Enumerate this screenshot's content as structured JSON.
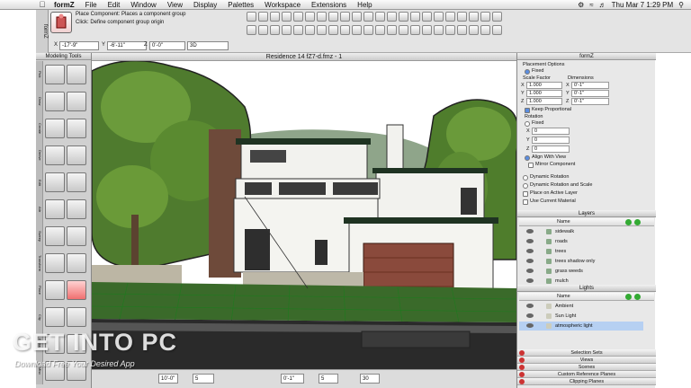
{
  "menubar": {
    "app": "formZ",
    "items": [
      "File",
      "Edit",
      "Window",
      "View",
      "Display",
      "Palettes",
      "Workspace",
      "Extensions",
      "Help"
    ],
    "clock": "Thu Mar 7  1:29 PM"
  },
  "toolbar": {
    "side_label": "formZ",
    "place_title": "Place Component:",
    "place_desc": "Places a component group",
    "place_hint": "Click: Define component group origin",
    "coords": {
      "x_label": "X",
      "x": "-17'-9\"",
      "y_label": "Y",
      "y": "-6'-11\"",
      "z_label": "Z",
      "z": "0'-0\"",
      "mode": "3D"
    }
  },
  "tools": {
    "title": "Modeling Tools",
    "groups": [
      "Pick",
      "Draw",
      "Create",
      "Derive",
      "Edit",
      "Attr",
      "Sweep",
      "Transform",
      "Place",
      "Clip",
      "Extras",
      "Misc"
    ]
  },
  "viewport": {
    "title": "Residence 14 fZ7-d.fmz - 1"
  },
  "status": {
    "zoom": "10'-0\"",
    "snap": "5",
    "dist": "0'-1\"",
    "count": "5",
    "angle": "30"
  },
  "panel": {
    "title": "formZ",
    "placement_options": "Placement Options",
    "fixed_label": "Fixed",
    "scale_factor": "Scale Factor",
    "dimensions": "Dimensions",
    "scale": {
      "x": "1.000",
      "y": "1.000",
      "z": "1.000"
    },
    "dims": {
      "x": "0'-1\"",
      "y": "0'-1\"",
      "z": "0'-1\""
    },
    "keep_proportional": "Keep Proportional",
    "rotation": "Rotation",
    "rot_fixed": "Fixed",
    "rot": {
      "x": "0",
      "y": "0",
      "z": "0"
    },
    "align_with_view": "Align With View",
    "mirror_component": "Mirror Component",
    "dynamic_rotation": "Dynamic Rotation",
    "dynamic_rotation_scale": "Dynamic Rotation and Scale",
    "place_active_layer": "Place on Active Layer",
    "use_current_material": "Use Current Material",
    "axis_labels": {
      "x": "X",
      "y": "Y",
      "z": "Z"
    }
  },
  "layers": {
    "title": "Layers",
    "col_name": "Name",
    "rows": [
      "sidewalk",
      "roads",
      "trees",
      "trees shadow only",
      "grass weeds",
      "mulch"
    ]
  },
  "lights": {
    "title": "Lights",
    "col_name": "Name",
    "rows": [
      "Ambient",
      "Sun Light",
      "atmospheric light"
    ]
  },
  "collapsed_panels": [
    "Selection Sets",
    "Views",
    "Scenes",
    "Custom Reference Planes",
    "Clipping Planes"
  ],
  "watermark": {
    "line1": "GET INTO PC",
    "line2": "Download Free Your Desired App"
  },
  "colors": {
    "sky": "#ffffff",
    "tree": "#4e7a2e",
    "wall": "#f4f4f0",
    "roof": "#1f3322",
    "garage": "#8a4a3c",
    "grid": "#2a8a2a",
    "selected_row": "#b6d0f2"
  }
}
